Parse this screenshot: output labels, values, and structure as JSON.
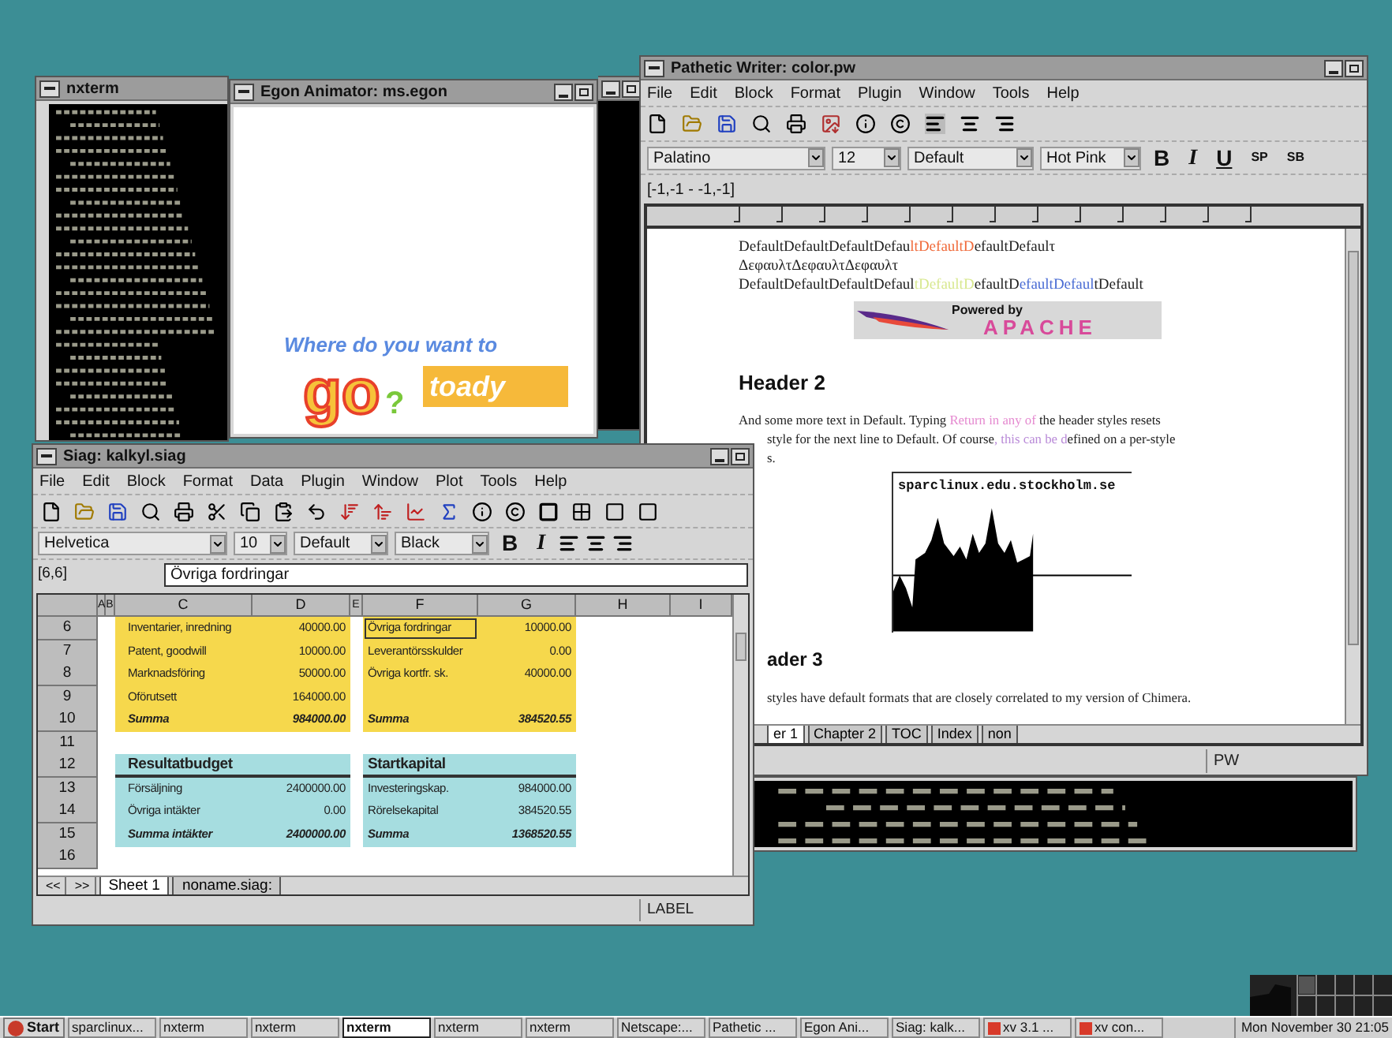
{
  "xterm_left": {
    "title": "nxterm"
  },
  "egon": {
    "title": "Egon Animator: ms.egon",
    "headline": "Where do you want to",
    "big_word": "go",
    "overlay_word": "toady",
    "mark": "?"
  },
  "writer": {
    "title": "Pathetic Writer: color.pw",
    "menu": [
      "File",
      "Edit",
      "Block",
      "Format",
      "Plugin",
      "Window",
      "Tools",
      "Help"
    ],
    "font": "Palatino",
    "size": "12",
    "style": "Default",
    "color_name": "Hot Pink",
    "format_buttons": [
      "B",
      "I",
      "U",
      "SP",
      "SB"
    ],
    "position": "[-1,-1 - -1,-1]",
    "lines": [
      {
        "segments": [
          {
            "text": "DefaultDefaultDefaultDefau",
            "color": "#222222"
          },
          {
            "text": "ltDefaultD",
            "color": "#f06a3a"
          },
          {
            "text": "efaultDefaulτ",
            "color": "#222222"
          }
        ]
      },
      {
        "segments": [
          {
            "text": "ΔεφαυλτΔεφαυλτΔεφαυλτ",
            "color": "#222222"
          }
        ]
      },
      {
        "segments": [
          {
            "text": "DefaultDefaultDefaultDefaul",
            "color": "#222222"
          },
          {
            "text": "tDefaultD",
            "color": "#d8e890"
          },
          {
            "text": "efaultD",
            "color": "#222222"
          },
          {
            "text": "efaultDefaul",
            "color": "#4a6cd4"
          },
          {
            "text": "tDefault",
            "color": "#222222"
          }
        ]
      }
    ],
    "logo": {
      "top": "Powered by",
      "bottom": "APACHE"
    },
    "header_2": "Header 2",
    "paragraph": [
      {
        "segments": [
          {
            "text": "And some more text in Default. Typing ",
            "color": "#222222"
          },
          {
            "text": "Return in any of",
            "color": "#e58ad0"
          },
          {
            "text": " the header styles resets",
            "color": "#222222"
          }
        ]
      },
      {
        "segments": [
          {
            "text": "style for the next line to Default. Of course",
            "color": "#222222"
          },
          {
            "text": ", this can be d",
            "color": "#b98ad8"
          },
          {
            "text": "efined on a per-style",
            "color": "#222222"
          }
        ]
      },
      {
        "segments": [
          {
            "text": "s.",
            "color": "#222222"
          }
        ]
      }
    ],
    "graph_title": "sparclinux.edu.stockholm.se",
    "header_3": "ader 3",
    "paragraph_2": "styles have default formats that are closely correlated to my version of Chimera.",
    "tabs": [
      {
        "label": "er 1",
        "selected": true
      },
      {
        "label": "Chapter 2",
        "selected": false
      },
      {
        "label": "TOC",
        "selected": false
      },
      {
        "label": "Index",
        "selected": false
      },
      {
        "label": "non",
        "selected": false
      }
    ],
    "status": "PW"
  },
  "siag": {
    "title": "Siag: kalkyl.siag",
    "menu": [
      "File",
      "Edit",
      "Block",
      "Format",
      "Data",
      "Plugin",
      "Window",
      "Plot",
      "Tools",
      "Help"
    ],
    "font": "Helvetica",
    "size": "10",
    "style": "Default",
    "color_name": "Black",
    "format_buttons": [
      "B",
      "I"
    ],
    "cell_ref": "[6,6]",
    "cell_value": "Övriga fordringar",
    "columns": [
      "A",
      "B",
      "C",
      "D",
      "E",
      "F",
      "G",
      "H",
      "I"
    ],
    "rows": [
      {
        "number": "6",
        "kind": "plain",
        "color": "#f6d84c",
        "cells": [
          {
            "text": "Inventarier, inredning",
            "selected": false
          },
          {
            "text": "40000.00",
            "selected": false
          },
          {
            "text": "Övriga fordringar",
            "selected": true
          },
          {
            "text": "10000.00",
            "selected": false
          }
        ]
      },
      {
        "number": "7",
        "kind": "plain",
        "color": "#f6d84c",
        "cells": [
          {
            "text": "Patent, goodwill",
            "selected": false
          },
          {
            "text": "10000.00",
            "selected": false
          },
          {
            "text": "Leverantörsskulder",
            "selected": false
          },
          {
            "text": "0.00",
            "selected": false
          }
        ]
      },
      {
        "number": "8",
        "kind": "plain",
        "color": "#f6d84c",
        "cells": [
          {
            "text": "Marknadsföring",
            "selected": false
          },
          {
            "text": "50000.00",
            "selected": false
          },
          {
            "text": "Övriga kortfr. sk.",
            "selected": false
          },
          {
            "text": "40000.00",
            "selected": false
          }
        ]
      },
      {
        "number": "9",
        "kind": "plain",
        "color": "#f6d84c",
        "cells": [
          {
            "text": "Oförutsett",
            "selected": false
          },
          {
            "text": "164000.00",
            "selected": false
          },
          {
            "selected": false
          },
          {
            "selected": false
          }
        ]
      },
      {
        "number": "10",
        "kind": "total",
        "color": "#f6d84c",
        "cells": [
          {
            "text": "Summa",
            "selected": false
          },
          {
            "text": "984000.00",
            "selected": false
          },
          {
            "text": "Summa",
            "selected": false
          },
          {
            "text": "384520.55",
            "selected": false
          }
        ]
      },
      {
        "number": "11",
        "kind": "blank"
      },
      {
        "number": "12",
        "kind": "heading",
        "color": "#a6dde0",
        "cells": [
          {
            "text": "Resultatbudget",
            "selected": false
          },
          {
            "selected": false
          },
          {
            "text": "Startkapital",
            "selected": false
          },
          {
            "selected": false
          }
        ]
      },
      {
        "number": "13",
        "kind": "plain",
        "color": "#a6dde0",
        "cells": [
          {
            "text": "Försäljning",
            "selected": false
          },
          {
            "text": "2400000.00",
            "selected": false
          },
          {
            "text": "Investeringskap.",
            "selected": false
          },
          {
            "text": "984000.00",
            "selected": false
          }
        ]
      },
      {
        "number": "14",
        "kind": "plain",
        "color": "#a6dde0",
        "cells": [
          {
            "text": "Övriga intäkter",
            "selected": false
          },
          {
            "text": "0.00",
            "selected": false
          },
          {
            "text": "Rörelsekapital",
            "selected": false
          },
          {
            "text": "384520.55",
            "selected": false
          }
        ]
      },
      {
        "number": "15",
        "kind": "total",
        "color": "#a6dde0",
        "cells": [
          {
            "text": "Summa intäkter",
            "selected": false
          },
          {
            "text": "2400000.00",
            "selected": false
          },
          {
            "text": "Summa",
            "selected": false
          },
          {
            "text": "1368520.55",
            "selected": false
          }
        ]
      },
      {
        "number": "16",
        "kind": "blank"
      }
    ],
    "sheet_nav": [
      "<<",
      ">>"
    ],
    "tabs": [
      {
        "label": "Sheet 1",
        "selected": true
      },
      {
        "label": "noname.siag:",
        "selected": false
      }
    ],
    "status": "LABEL"
  },
  "taskbar": {
    "start": "Start",
    "items": [
      {
        "label": "sparclinux...",
        "selected": false,
        "has_icon": false
      },
      {
        "label": "nxterm",
        "selected": false,
        "has_icon": false
      },
      {
        "label": "nxterm",
        "selected": false,
        "has_icon": false
      },
      {
        "label": "nxterm",
        "selected": true,
        "has_icon": false
      },
      {
        "label": "nxterm",
        "selected": false,
        "has_icon": false
      },
      {
        "label": "nxterm",
        "selected": false,
        "has_icon": false
      },
      {
        "label": "Netscape:...",
        "selected": false,
        "has_icon": false
      },
      {
        "label": "Pathetic ...",
        "selected": false,
        "has_icon": false
      },
      {
        "label": "Egon Ani...",
        "selected": false,
        "has_icon": false
      },
      {
        "label": "Siag: kalk...",
        "selected": false,
        "has_icon": false
      },
      {
        "label": "xv 3.1 ...",
        "selected": false,
        "has_icon": true
      },
      {
        "label": "xv con...",
        "selected": false,
        "has_icon": true
      }
    ],
    "clock": "Mon November 30 21:05"
  }
}
